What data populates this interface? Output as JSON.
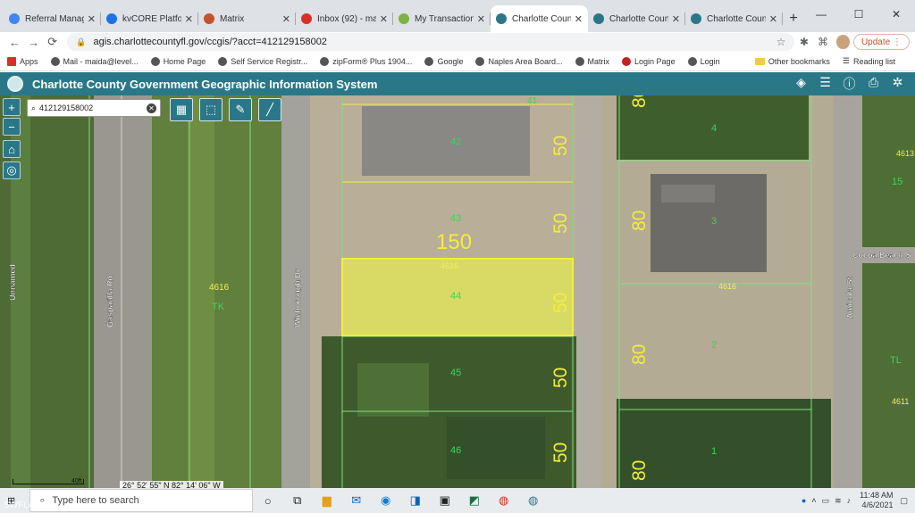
{
  "tabs": [
    {
      "label": "Referral Manager",
      "color": "#4285f4",
      "active": false
    },
    {
      "label": "kvCORE Platform",
      "color": "#1a73e8",
      "active": false
    },
    {
      "label": "Matrix",
      "color": "#c5522e",
      "active": false
    },
    {
      "label": "Inbox (92) - maida@",
      "color": "#d93025",
      "active": false
    },
    {
      "label": "My Transactions |",
      "color": "#7cb342",
      "active": false
    },
    {
      "label": "Charlotte County",
      "color": "#2a7887",
      "active": true
    },
    {
      "label": "Charlotte County",
      "color": "#2a7887",
      "active": false
    },
    {
      "label": "Charlotte County",
      "color": "#2a7887",
      "active": false
    }
  ],
  "address": {
    "url": "agis.charlottecountyfl.gov/ccgis/?acct=412129158002",
    "update_label": "Update"
  },
  "bookmarks": [
    "Apps",
    "Mail - maida@level...",
    "Home Page",
    "Self Service Registr...",
    "zipForm® Plus 1904...",
    "Google",
    "Naples Area Board...",
    "Matrix",
    "Login Page",
    "Login"
  ],
  "bookmarks_right": {
    "other": "Other bookmarks",
    "reading": "Reading list"
  },
  "gis": {
    "title": "Charlotte County Government Geographic Information System"
  },
  "map": {
    "search_value": "412129158002",
    "coords": "26° 52' 55\" N 82° 14' 06\" W",
    "scale_label": "40ft",
    "street_labels": {
      "unnamed": "Unnamed",
      "gasparilla": "Gasparilla Rd",
      "winborough": "Winborough Dr",
      "amicola": "Amicola St",
      "cocoa": "Cocoa Beach S"
    },
    "zone_labels": {
      "block": "4616",
      "zone": "TK",
      "zone2": "TL",
      "block_right": "4611",
      "block_right2": "4613",
      "lot15": "15"
    },
    "lots_left": [
      {
        "lot": "41",
        "dim": ""
      },
      {
        "lot": "42",
        "dim": "50"
      },
      {
        "lot": "43",
        "dim": "50"
      },
      {
        "lot": "44",
        "dim": "50"
      },
      {
        "lot": "45",
        "dim": "50"
      },
      {
        "lot": "46",
        "dim": "50"
      }
    ],
    "lots_right": [
      {
        "lot": "4",
        "dim": "80"
      },
      {
        "lot": "3",
        "dim": "80"
      },
      {
        "lot": "2",
        "dim": "80"
      },
      {
        "lot": "1",
        "dim": "80"
      }
    ],
    "width_dim": "150",
    "selected_block": "4616",
    "right_block": "4616",
    "highlight_color": "#f2ff3d"
  },
  "taskbar": {
    "search_placeholder": "Type here to search",
    "time": "11:48 AM",
    "date": "4/6/2021",
    "watermark": "SWFLAMLS"
  }
}
